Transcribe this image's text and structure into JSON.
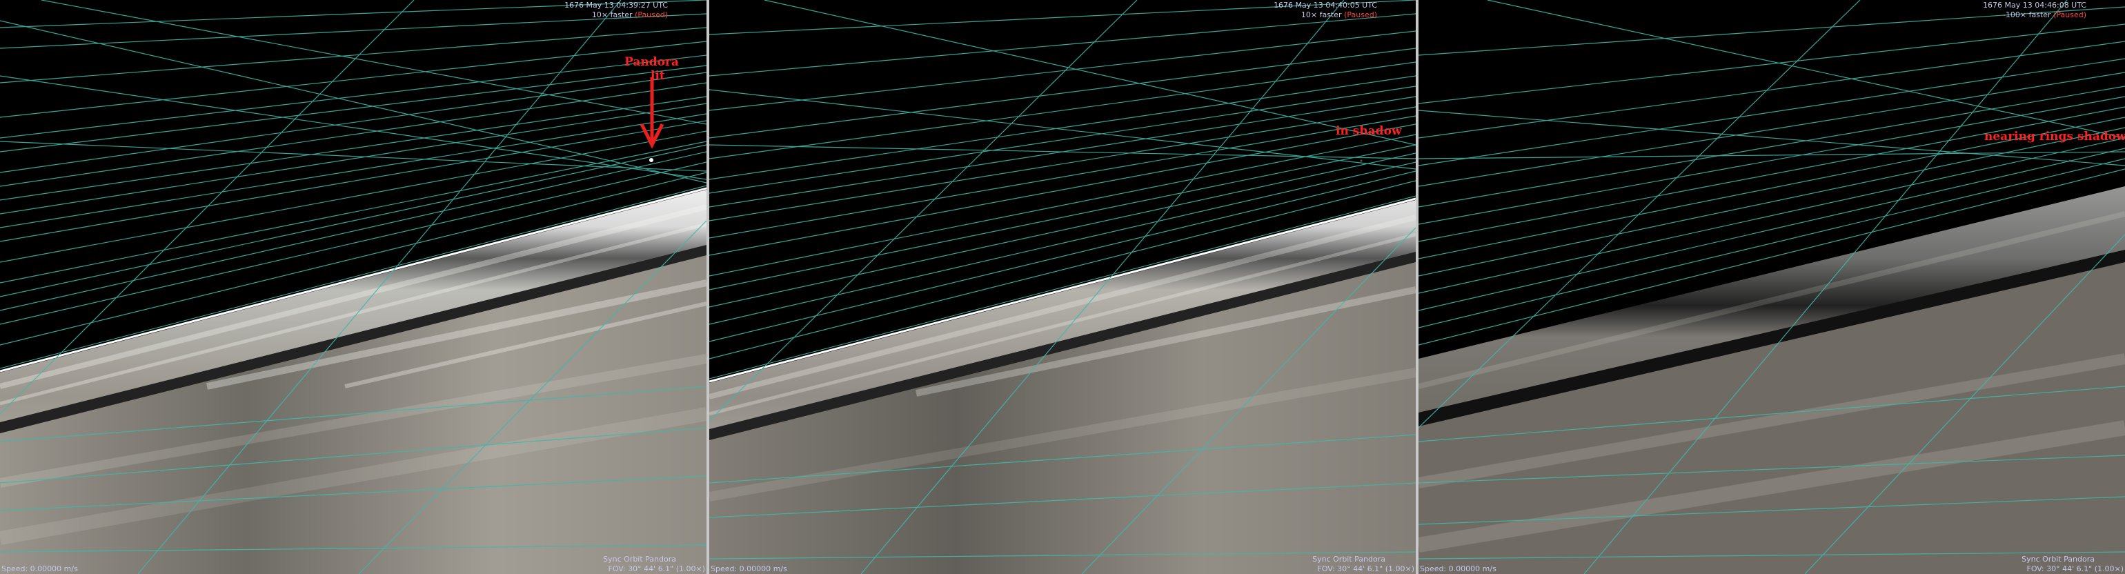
{
  "panels": [
    {
      "hud": {
        "time": "1676 May 13 04:39:27 UTC",
        "rate": "10× faster",
        "paused": "(Paused)",
        "speed": "Speed: 0.00000 m/s",
        "sync": "Sync Orbit Pandora",
        "fov": "FOV: 30° 44' 6.1\" (1.00×)"
      },
      "annotation": {
        "line1": "Pandora",
        "line2": "lit",
        "color": "#ff2020"
      },
      "rings": {
        "brightness": "lit"
      }
    },
    {
      "hud": {
        "time": "1676 May 13 04:40:05 UTC",
        "rate": "10× faster",
        "paused": "(Paused)",
        "speed": "Speed: 0.00000 m/s",
        "sync": "Sync Orbit Pandora",
        "fov": "FOV: 30° 44' 6.1\" (1.00×)"
      },
      "annotation": {
        "line1": "in shadow",
        "color": "#ff2020"
      },
      "rings": {
        "brightness": "lit"
      }
    },
    {
      "hud": {
        "time": "1676 May 13 04:46:08 UTC",
        "rate": "-100× faster",
        "paused": "(Paused)",
        "speed": "Speed: 0.00000 m/s",
        "sync": "Sync Orbit Pandora",
        "fov": "FOV: 30° 44' 6.1\" (1.00×)"
      },
      "annotation": {
        "line1": "nearing rings shadow",
        "color": "#ff2020"
      },
      "rings": {
        "brightness": "dim"
      }
    }
  ],
  "colors": {
    "orbit_lines": "#3fb8a8",
    "hud_text": "#c8c8e6",
    "paused": "#ff4040",
    "annotation": "#ff2020",
    "divider": "#c8c8c8"
  }
}
